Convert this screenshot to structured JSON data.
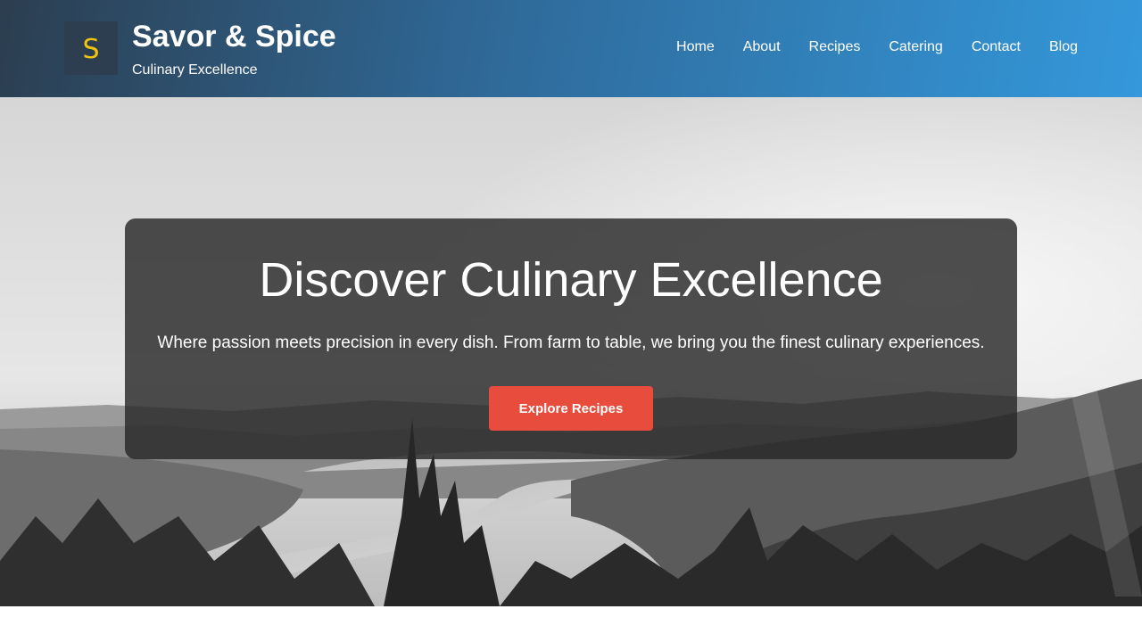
{
  "brand": {
    "logo_letter": "S",
    "logo_letter_color": "#f1c40f",
    "name": "Savor & Spice",
    "tagline": "Culinary Excellence"
  },
  "nav": {
    "items": [
      "Home",
      "About",
      "Recipes",
      "Catering",
      "Contact",
      "Blog"
    ]
  },
  "hero": {
    "background": "grayscale landscape photo: river valley with forested hills and pine trees",
    "title": "Discover Culinary Excellence",
    "subtitle": "Where passion meets precision in every dish. From farm to table, we bring you the finest culinary experiences.",
    "cta_label": "Explore Recipes",
    "cta_color": "#e74c3c"
  },
  "colors": {
    "header_start": "#2c3e50",
    "header_end": "#3498db",
    "card_bg": "rgba(40,40,40,0.82)"
  }
}
